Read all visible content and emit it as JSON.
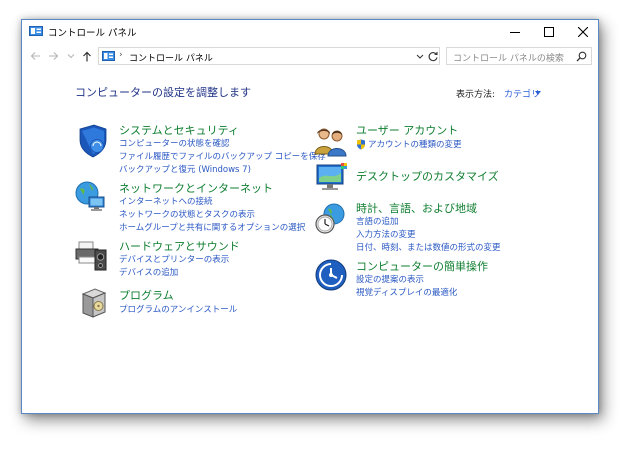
{
  "window": {
    "title": "コントロール パネル",
    "controls": {
      "minimize": "─",
      "maximize": "☐",
      "close": "✕"
    }
  },
  "address": {
    "separator": "›",
    "crumb": "コントロール パネル",
    "search_placeholder": "コントロール パネルの検索"
  },
  "main": {
    "heading": "コンピューターの設定を調整します",
    "view_by_label": "表示方法:",
    "view_by_value": "カテゴリ"
  },
  "left_categories": [
    {
      "title": "システムとセキュリティ",
      "icon": "security-shield-icon",
      "links": [
        "コンピューターの状態を確認",
        "ファイル履歴でファイルのバックアップ コピーを保存",
        "バックアップと復元 (Windows 7)"
      ]
    },
    {
      "title": "ネットワークとインターネット",
      "icon": "network-globe-icon",
      "links": [
        "インターネットへの接続",
        "ネットワークの状態とタスクの表示",
        "ホームグループと共有に関するオプションの選択"
      ]
    },
    {
      "title": "ハードウェアとサウンド",
      "icon": "printer-speaker-icon",
      "links": [
        "デバイスとプリンターの表示",
        "デバイスの追加"
      ]
    },
    {
      "title": "プログラム",
      "icon": "program-box-icon",
      "links": [
        "プログラムのアンインストール"
      ]
    }
  ],
  "right_categories": [
    {
      "title": "ユーザー アカウント",
      "icon": "user-accounts-icon",
      "links": [
        "アカウントの種類の変更"
      ]
    },
    {
      "title": "デスクトップのカスタマイズ",
      "icon": "desktop-monitor-icon",
      "links": []
    },
    {
      "title": "時計、言語、および地域",
      "icon": "clock-globe-icon",
      "links": [
        "言語の追加",
        "入力方法の変更",
        "日付、時刻、または数値の形式の変更"
      ]
    },
    {
      "title": "コンピューターの簡単操作",
      "icon": "ease-of-access-icon",
      "links": [
        "設定の提案の表示",
        "視覚ディスプレイの最適化"
      ]
    }
  ],
  "colors": {
    "heading": "#1e3287",
    "category_title": "#0e7e2f",
    "link": "#2a58c4",
    "window_border": "#5a88c5"
  }
}
